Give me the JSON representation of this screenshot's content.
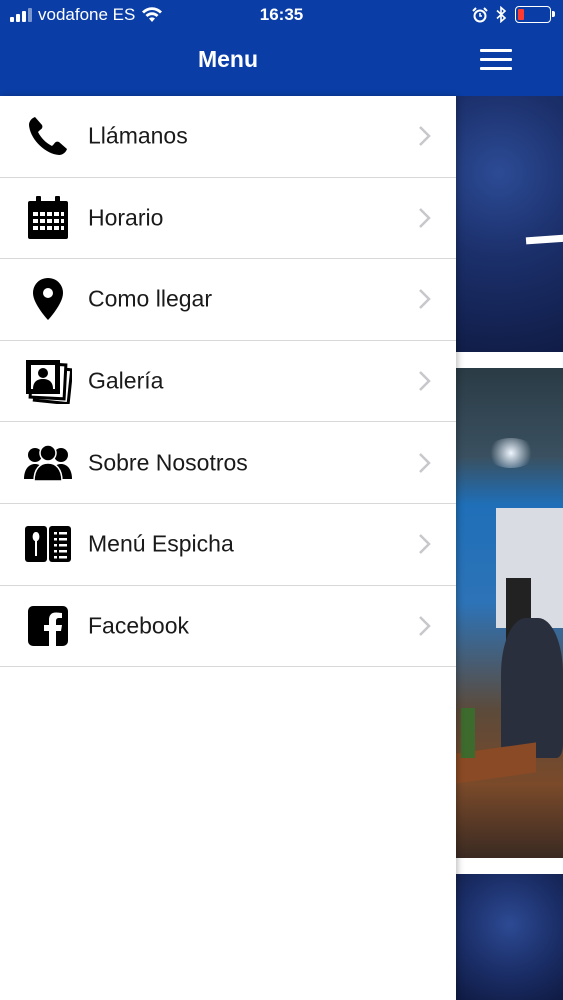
{
  "status_bar": {
    "carrier": "vodafone ES",
    "time": "16:35"
  },
  "header": {
    "title": "Menu"
  },
  "menu": {
    "items": [
      {
        "label": "Llámanos",
        "icon": "phone-icon"
      },
      {
        "label": "Horario",
        "icon": "calendar-icon"
      },
      {
        "label": "Como llegar",
        "icon": "location-pin-icon"
      },
      {
        "label": "Galería",
        "icon": "photo-gallery-icon"
      },
      {
        "label": "Sobre Nosotros",
        "icon": "group-icon"
      },
      {
        "label": "Menú Espicha",
        "icon": "menu-book-icon"
      },
      {
        "label": "Facebook",
        "icon": "facebook-icon"
      }
    ]
  },
  "colors": {
    "header_blue": "#0a3ea6",
    "battery_low": "#ff3b30"
  }
}
